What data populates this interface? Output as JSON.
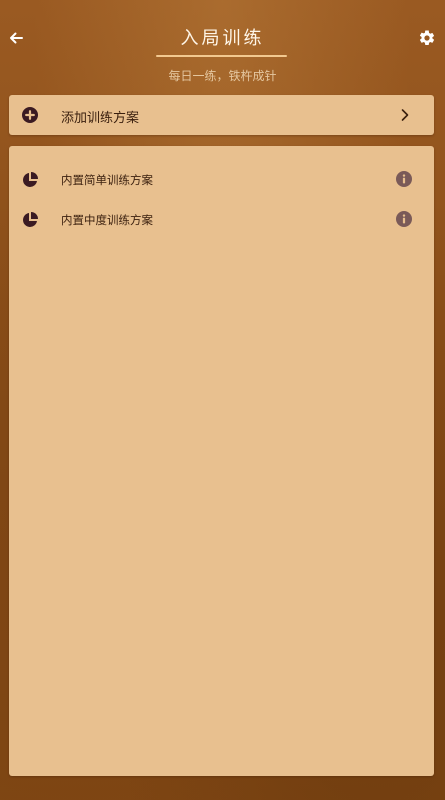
{
  "header": {
    "title": "入局训练",
    "subtitle": "每日一练，铁杵成针",
    "back_icon": "arrow-left-icon",
    "settings_icon": "gear-icon"
  },
  "add_plan": {
    "label": "添加训练方案",
    "icon": "plus-circle-icon",
    "chevron_icon": "chevron-right-icon"
  },
  "plans": [
    {
      "label": "内置简单训练方案",
      "icon": "pie-chart-icon",
      "info_icon": "info-icon"
    },
    {
      "label": "内置中度训练方案",
      "icon": "pie-chart-icon",
      "info_icon": "info-icon"
    }
  ],
  "colors": {
    "card": "#e8c08f",
    "text": "#3a1f0e",
    "icon": "#3a1a22",
    "info": "#7a5a58",
    "accent": "#f2c990"
  }
}
